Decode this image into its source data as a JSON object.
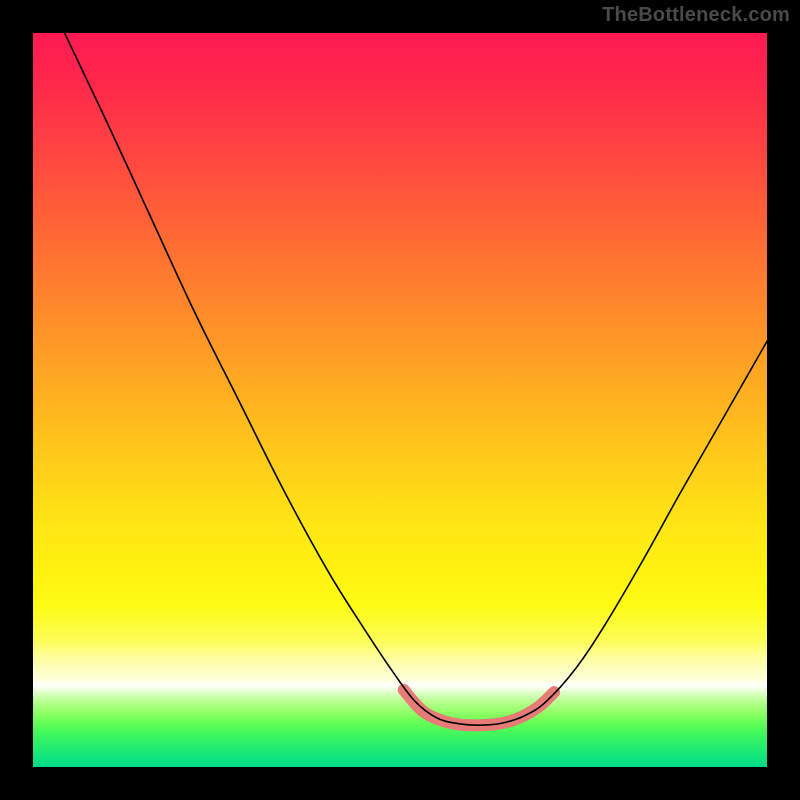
{
  "watermark": "TheBottleneck.com",
  "chart_data": {
    "type": "line",
    "title": "",
    "xlabel": "",
    "ylabel": "",
    "xlim": [
      0,
      100
    ],
    "ylim": [
      0,
      100
    ],
    "grid": false,
    "legend": false,
    "note": "Bottleneck-style V-curve on a rainbow heat gradient. Values are percentages of the plot area (0,0 = top-left; y increases downward). Left branch falls steeply from upper-left, flattens into a trough near x≈55–67, then rises to the right edge at mid-height. The red segment tags the optimum trough.",
    "series": [
      {
        "name": "curve",
        "color": "#000000",
        "points_xy_pct": [
          [
            4.3,
            0.0
          ],
          [
            10.0,
            12.0
          ],
          [
            16.0,
            25.0
          ],
          [
            22.0,
            38.0
          ],
          [
            28.0,
            50.0
          ],
          [
            34.0,
            62.0
          ],
          [
            40.0,
            73.0
          ],
          [
            45.0,
            81.0
          ],
          [
            49.0,
            87.0
          ],
          [
            52.0,
            91.0
          ],
          [
            55.0,
            93.3
          ],
          [
            58.0,
            94.1
          ],
          [
            61.0,
            94.3
          ],
          [
            64.0,
            94.0
          ],
          [
            67.0,
            93.0
          ],
          [
            70.0,
            91.0
          ],
          [
            74.0,
            86.5
          ],
          [
            78.0,
            80.5
          ],
          [
            83.0,
            72.0
          ],
          [
            88.0,
            63.0
          ],
          [
            94.0,
            52.5
          ],
          [
            100.0,
            42.0
          ]
        ]
      },
      {
        "name": "optimum-highlight",
        "color": "#e77b77",
        "points_xy_pct": [
          [
            50.5,
            89.5
          ],
          [
            53.0,
            92.3
          ],
          [
            55.5,
            93.6
          ],
          [
            58.0,
            94.2
          ],
          [
            61.0,
            94.3
          ],
          [
            64.0,
            94.0
          ],
          [
            66.5,
            93.2
          ],
          [
            69.0,
            91.7
          ],
          [
            71.0,
            89.8
          ]
        ]
      }
    ],
    "background_gradient_stops": [
      {
        "pct": 0,
        "color": "#ff1a52"
      },
      {
        "pct": 50,
        "color": "#ffb220"
      },
      {
        "pct": 78,
        "color": "#fdfb14"
      },
      {
        "pct": 89,
        "color": "#ffffff"
      },
      {
        "pct": 100,
        "color": "#00db89"
      }
    ]
  }
}
